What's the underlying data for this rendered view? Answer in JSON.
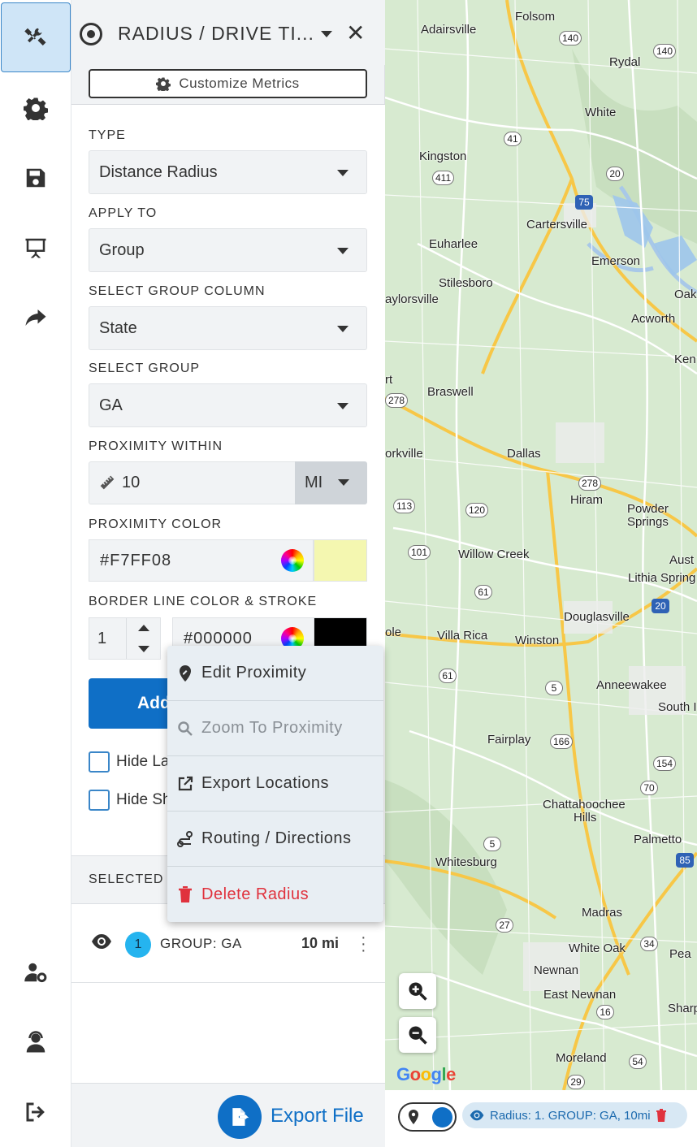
{
  "panel": {
    "title": "RADIUS / DRIVE TI...",
    "customize_label": "Customize Metrics"
  },
  "form": {
    "type_label": "TYPE",
    "type_value": "Distance Radius",
    "apply_label": "APPLY TO",
    "apply_value": "Group",
    "group_col_label": "SELECT GROUP COLUMN",
    "group_col_value": "State",
    "group_label": "SELECT GROUP",
    "group_value": "GA",
    "prox_label": "PROXIMITY WITHIN",
    "prox_value": "10",
    "prox_unit": "MI",
    "prox_color_label": "PROXIMITY COLOR",
    "prox_color_value": "#F7FF08",
    "prox_color_swatch": "#f4f7b0",
    "border_label": "BORDER LINE COLOR & STROKE",
    "stroke_value": "1",
    "border_color_value": "#000000",
    "border_color_swatch": "#000000",
    "add_label": "Add",
    "hide1_label": "Hide La",
    "hide2_label": "Hide Sh"
  },
  "selected": {
    "header": "SELECTED",
    "rows": [
      {
        "badge": "1",
        "label": "GROUP: GA",
        "dist": "10 mi"
      }
    ]
  },
  "context_menu": {
    "items": [
      {
        "label": "Edit Proximity",
        "icon": "map-marker-edit-icon"
      },
      {
        "label": "Zoom To Proximity",
        "icon": "search-icon"
      },
      {
        "label": "Export Locations",
        "icon": "external-link-icon"
      },
      {
        "label": "Routing / Directions",
        "icon": "route-icon"
      },
      {
        "label": "Delete Radius",
        "icon": "trash-icon"
      }
    ]
  },
  "footer": {
    "export_label": "Export File"
  },
  "map": {
    "labels": [
      "Folsom",
      "Adairsville",
      "Rydal",
      "White",
      "Kingston",
      "Cartersville",
      "Euharlee",
      "Emerson",
      "Stilesboro",
      "aylorsville",
      "Oak",
      "Acworth",
      "Ken",
      "rt",
      "Braswell",
      "orkville",
      "Dallas",
      "Hiram",
      "Powder",
      "Springs",
      "Willow Creek",
      "Aust",
      "Lithia Spring",
      "Douglasville",
      "ole",
      "Villa Rica",
      "Winston",
      "Anneewakee",
      "South I",
      "Fairplay",
      "Chattahoochee",
      "Hills",
      "Palmetto",
      "Whitesburg",
      "Madras",
      "White Oak",
      "Pea",
      "Newnan",
      "East Newnan",
      "Sharpsbu",
      "Moreland"
    ],
    "shields": [
      "140",
      "140",
      "41",
      "411",
      "20",
      "75",
      "278",
      "113",
      "120",
      "278",
      "101",
      "61",
      "20",
      "61",
      "5",
      "166",
      "154",
      "70",
      "5",
      "85",
      "27",
      "34",
      "16",
      "54",
      "29"
    ],
    "chip_label": "Radius: 1. GROUP: GA, 10mi",
    "google": "Google"
  },
  "colors": {
    "accent": "#0f6fc6",
    "danger": "#e0323d",
    "badge": "#25b4ef",
    "map_bg": "#d7ead0"
  }
}
